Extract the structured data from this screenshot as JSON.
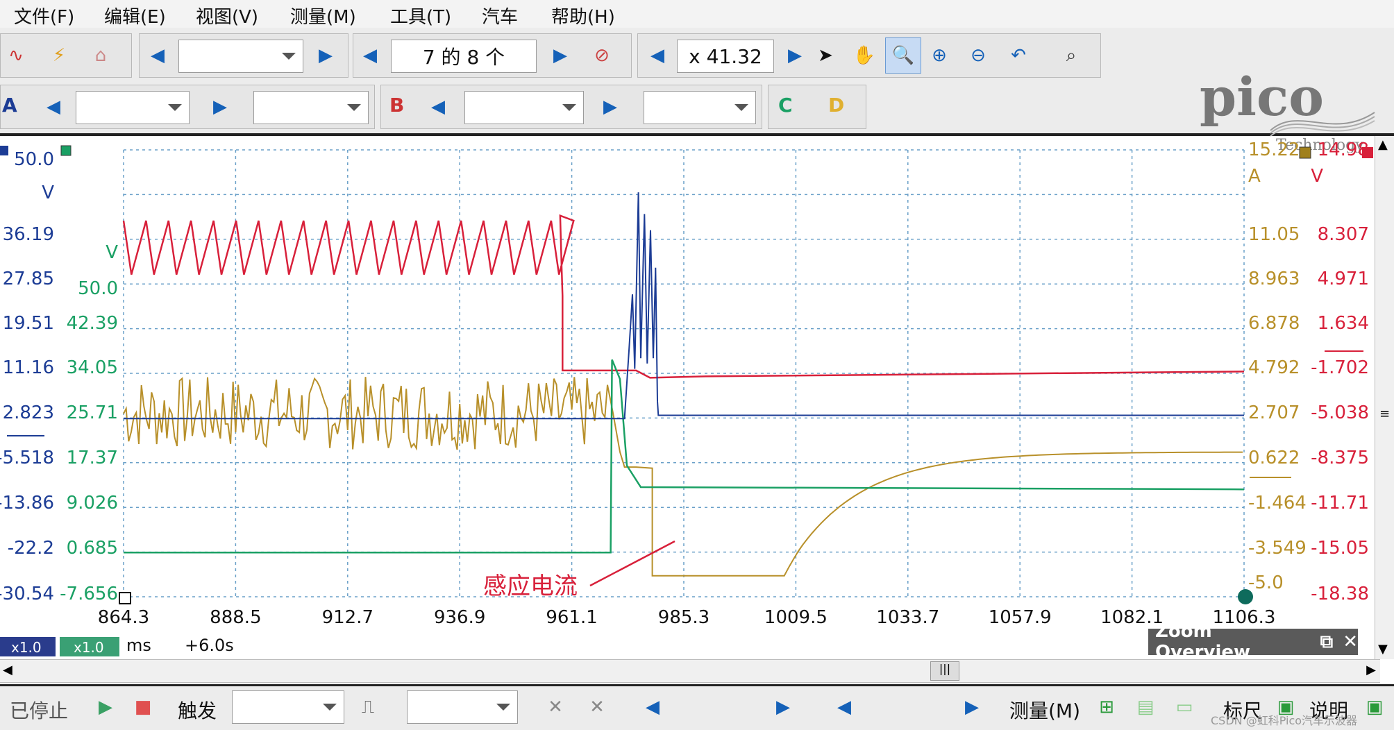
{
  "menu": [
    "文件(F)",
    "编辑(E)",
    "视图(V)",
    "测量(M)",
    "工具(T)",
    "汽车",
    "帮助(H)"
  ],
  "toolbar": {
    "buffer_label": "7 的 8 个",
    "zoom_label": "x 41.32",
    "channels": [
      "A",
      "B",
      "C",
      "D"
    ]
  },
  "logo": {
    "brand": "pico",
    "sub": "Technology"
  },
  "annotation": "感应电流",
  "axes": {
    "blue_ticks": [
      "50.0",
      "36.19",
      "27.85",
      "19.51",
      "11.16",
      "2.823",
      "-5.518",
      "-13.86",
      "-22.2",
      "-30.54"
    ],
    "blue_unit": "V",
    "green_ticks": [
      "50.0",
      "42.39",
      "34.05",
      "25.71",
      "17.37",
      "9.026",
      "0.685",
      "-7.656"
    ],
    "green_unit": "V",
    "gold_ticks": [
      "15.22",
      "11.05",
      "8.963",
      "6.878",
      "4.792",
      "2.707",
      "0.622",
      "-1.464",
      "-3.549",
      "-5.0"
    ],
    "gold_unit": "A",
    "red_ticks": [
      "14.98",
      "8.307",
      "4.971",
      "1.634",
      "-1.702",
      "-5.038",
      "-8.375",
      "-11.71",
      "-15.05",
      "-18.38"
    ],
    "red_unit": "V",
    "x_ticks": [
      "864.3",
      "888.5",
      "912.7",
      "936.9",
      "961.1",
      "985.3",
      "1009.5",
      "1033.7",
      "1057.9",
      "1082.1",
      "1106.3"
    ],
    "x_unit": "ms",
    "x_offset": "+6.0s",
    "scale_a": "x1.0",
    "scale_b": "x1.0"
  },
  "zoom_overview": "Zoom Overview",
  "status": {
    "state": "已停止",
    "trigger": "触发",
    "measure": "测量(M)",
    "ruler": "标尺",
    "notes": "说明"
  },
  "watermark": "CSDN @虹科Pico汽车示波器",
  "colors": {
    "red": "#d8203a",
    "blue": "#1c3c95",
    "green": "#1aa064",
    "gold": "#b8902a",
    "grid": "#6aa0c8"
  }
}
